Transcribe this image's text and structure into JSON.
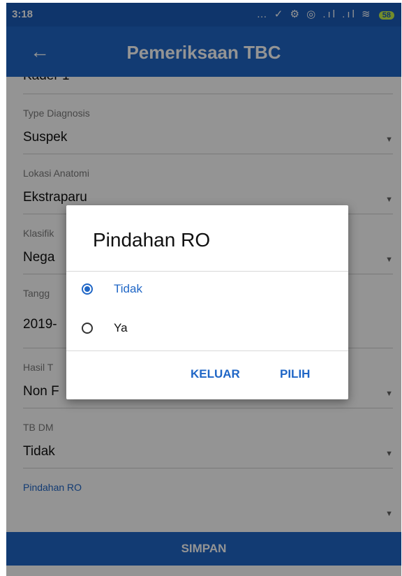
{
  "status_bar": {
    "time": "3:18",
    "icons": "… ✓ ⚙ ◎ .ıl .ıl ≋",
    "battery": "58"
  },
  "app_bar": {
    "title": "Pemeriksaan TBC"
  },
  "form": {
    "partial_top_value": "Kader 1",
    "fields": [
      {
        "label": "Type Diagnosis",
        "value": "Suspek"
      },
      {
        "label": "Lokasi Anatomi",
        "value": "Ekstraparu"
      },
      {
        "label": "Klasifik",
        "value": "Nega"
      },
      {
        "label": "Tangg",
        "value": "2019-"
      },
      {
        "label": "Hasil T",
        "value": "Non F"
      },
      {
        "label": "TB DM",
        "value": "Tidak"
      },
      {
        "label": "Pindahan RO",
        "value": ""
      }
    ],
    "submit_label": "SIMPAN"
  },
  "dialog": {
    "title": "Pindahan RO",
    "options": [
      {
        "label": "Tidak",
        "selected": true
      },
      {
        "label": "Ya",
        "selected": false
      }
    ],
    "cancel_label": "KELUAR",
    "confirm_label": "PILIH"
  },
  "colors": {
    "primary": "#1f66c6",
    "status_bar": "#1b5cb8",
    "battery": "#c7f24a"
  }
}
